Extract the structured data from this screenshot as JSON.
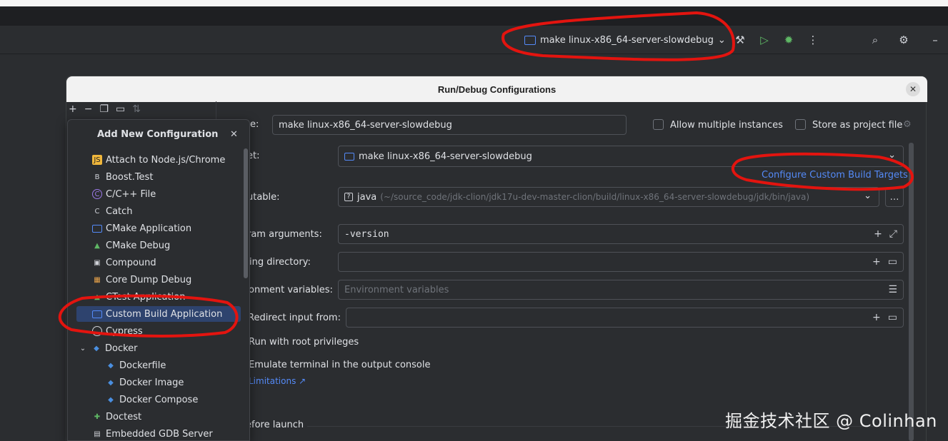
{
  "toolbar": {
    "run_config": "make linux-x86_64-server-slowdebug"
  },
  "dialog": {
    "title": "Run/Debug Configurations"
  },
  "popup": {
    "title": "Add New Configuration",
    "items": [
      {
        "label": "Attach to Node.js/Chrome"
      },
      {
        "label": "Boost.Test"
      },
      {
        "label": "C/C++ File"
      },
      {
        "label": "Catch"
      },
      {
        "label": "CMake Application"
      },
      {
        "label": "CMake Debug"
      },
      {
        "label": "Compound"
      },
      {
        "label": "Core Dump Debug"
      },
      {
        "label": "CTest Application"
      },
      {
        "label": "Custom Build Application"
      },
      {
        "label": "Cypress"
      },
      {
        "label": "Docker"
      },
      {
        "label": "Dockerfile"
      },
      {
        "label": "Docker Image"
      },
      {
        "label": "Docker Compose"
      },
      {
        "label": "Doctest"
      },
      {
        "label": "Embedded GDB Server"
      }
    ]
  },
  "form": {
    "name_label": "e:",
    "name_value": "make linux-x86_64-server-slowdebug",
    "allow_multiple": "Allow multiple instances",
    "store_project": "Store as project file",
    "target_label": "et:",
    "target_value": "make linux-x86_64-server-slowdebug",
    "configure_link": "Configure Custom Build Targets",
    "executable_label": "utable:",
    "executable_name": "java",
    "executable_path": "(~/source_code/jdk-clion/jdk17u-dev-master-clion/build/linux-x86_64-server-slowdebug/jdk/bin/java)",
    "program_args_label": "ram arguments:",
    "program_args_value": "-version",
    "working_dir_label": "ing directory:",
    "env_label": "onment variables:",
    "env_placeholder": "Environment variables",
    "redirect_label": "Redirect input from:",
    "root_priv": "Run with root privileges",
    "emulate_terminal": "Emulate terminal in the output console",
    "limitations_link": "Limitations ↗",
    "before_launch": "efore launch"
  },
  "watermark": "掘金技术社区 @ Colinhan"
}
